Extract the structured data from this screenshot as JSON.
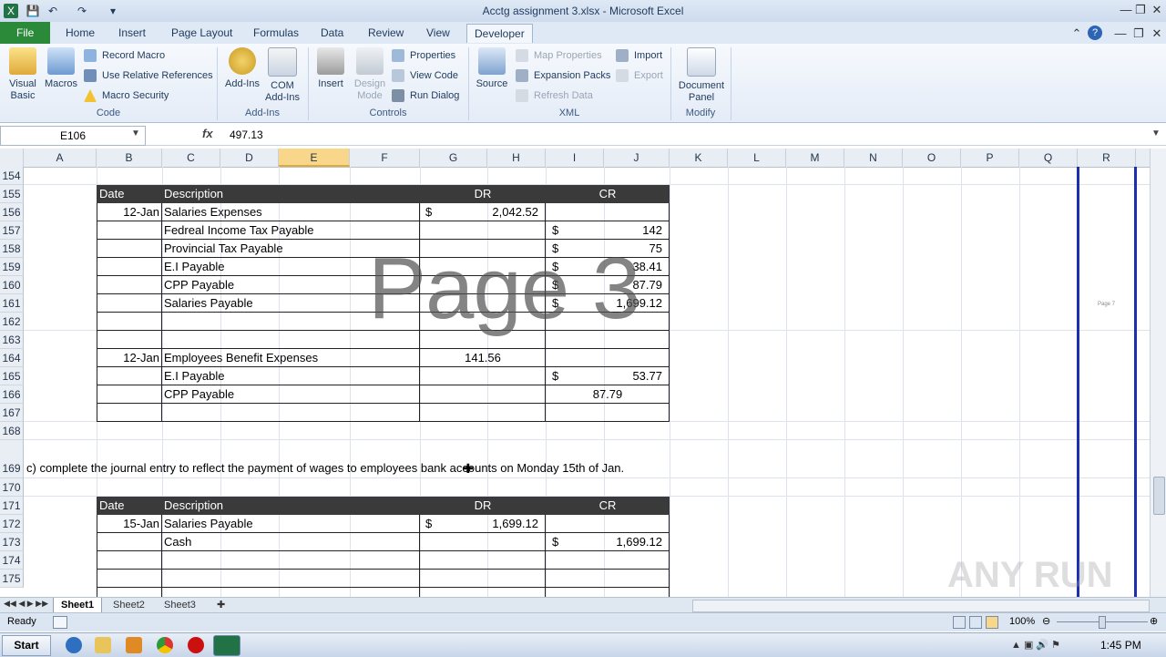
{
  "window": {
    "title": "Acctg assignment 3.xlsx - Microsoft Excel"
  },
  "tabs": [
    "File",
    "Home",
    "Insert",
    "Page Layout",
    "Formulas",
    "Data",
    "Review",
    "View",
    "Developer"
  ],
  "ribbon": {
    "code": {
      "label": "Code",
      "visual_basic": "Visual Basic",
      "macros": "Macros",
      "record_macro": "Record Macro",
      "relative_refs": "Use Relative References",
      "macro_security": "Macro Security"
    },
    "addins": {
      "label": "Add-Ins",
      "addins": "Add-Ins",
      "com_addins": "COM Add-Ins"
    },
    "controls": {
      "label": "Controls",
      "insert": "Insert",
      "design_mode": "Design Mode",
      "properties": "Properties",
      "view_code": "View Code",
      "run_dialog": "Run Dialog"
    },
    "xml": {
      "label": "XML",
      "source": "Source",
      "map_properties": "Map Properties",
      "expansion_packs": "Expansion Packs",
      "refresh_data": "Refresh Data",
      "import": "Import",
      "export": "Export"
    },
    "modify": {
      "label": "Modify",
      "document_panel": "Document Panel"
    }
  },
  "formula_bar": {
    "name_box": "E106",
    "fx": "fx",
    "value": "497.13"
  },
  "columns": [
    "A",
    "B",
    "C",
    "D",
    "E",
    "F",
    "G",
    "H",
    "I",
    "J",
    "K",
    "L",
    "M",
    "N",
    "O",
    "P",
    "Q",
    "R"
  ],
  "rows": [
    "154",
    "155",
    "156",
    "157",
    "158",
    "159",
    "160",
    "161",
    "162",
    "163",
    "164",
    "165",
    "166",
    "167",
    "168",
    "169",
    "170",
    "171",
    "172",
    "173",
    "174",
    "175"
  ],
  "table1": {
    "headers": {
      "date": "Date",
      "description": "Description",
      "dr": "DR",
      "cr": "CR"
    },
    "rows": [
      {
        "date": "12-Jan",
        "desc": "Salaries Expenses",
        "dr_sym": "$",
        "dr": "2,042.52",
        "cr_sym": "",
        "cr": ""
      },
      {
        "date": "",
        "desc": "Fedreal Income Tax Payable",
        "dr_sym": "",
        "dr": "",
        "cr_sym": "$",
        "cr": "142"
      },
      {
        "date": "",
        "desc": "Provincial Tax Payable",
        "dr_sym": "",
        "dr": "",
        "cr_sym": "$",
        "cr": "75"
      },
      {
        "date": "",
        "desc": "E.I Payable",
        "dr_sym": "",
        "dr": "",
        "cr_sym": "$",
        "cr": "38.41"
      },
      {
        "date": "",
        "desc": "CPP Payable",
        "dr_sym": "",
        "dr": "",
        "cr_sym": "$",
        "cr": "87.79"
      },
      {
        "date": "",
        "desc": "Salaries Payable",
        "dr_sym": "",
        "dr": "",
        "cr_sym": "$",
        "cr": "1,699.12"
      },
      {
        "date": "",
        "desc": "",
        "dr_sym": "",
        "dr": "",
        "cr_sym": "",
        "cr": ""
      },
      {
        "date": "",
        "desc": "",
        "dr_sym": "",
        "dr": "",
        "cr_sym": "",
        "cr": ""
      },
      {
        "date": "12-Jan",
        "desc": "Employees Benefit Expenses",
        "dr_sym": "",
        "dr": "141.56",
        "cr_sym": "",
        "cr": ""
      },
      {
        "date": "",
        "desc": "E.I Payable",
        "dr_sym": "",
        "dr": "",
        "cr_sym": "$",
        "cr": "53.77"
      },
      {
        "date": "",
        "desc": "CPP Payable",
        "dr_sym": "",
        "dr": "",
        "cr_sym": "",
        "cr": "87.79"
      },
      {
        "date": "",
        "desc": "",
        "dr_sym": "",
        "dr": "",
        "cr_sym": "",
        "cr": ""
      }
    ]
  },
  "instruction": "c) complete the journal entry to reflect the payment of wages to employees bank accounts on Monday 15th of Jan.",
  "table2": {
    "headers": {
      "date": "Date",
      "description": "Description",
      "dr": "DR",
      "cr": "CR"
    },
    "rows": [
      {
        "date": "15-Jan",
        "desc": "Salaries Payable",
        "dr_sym": "$",
        "dr": "1,699.12",
        "cr_sym": "",
        "cr": ""
      },
      {
        "date": "",
        "desc": "Cash",
        "dr_sym": "",
        "dr": "",
        "cr_sym": "$",
        "cr": "1,699.12"
      },
      {
        "date": "",
        "desc": "",
        "dr_sym": "",
        "dr": "",
        "cr_sym": "",
        "cr": ""
      },
      {
        "date": "",
        "desc": "",
        "dr_sym": "",
        "dr": "",
        "cr_sym": "",
        "cr": ""
      }
    ]
  },
  "watermark": "Page 3",
  "side_page_label": "Page 7",
  "sheets": [
    "Sheet1",
    "Sheet2",
    "Sheet3"
  ],
  "status": {
    "ready": "Ready",
    "zoom": "100%"
  },
  "taskbar": {
    "start": "Start",
    "time": "1:45 PM"
  },
  "anyrun": "ANY RUN",
  "colors": {
    "file_tab": "#2a8a3a",
    "header_row": "#3a3a3a",
    "selected_col": "#f8d78a"
  }
}
